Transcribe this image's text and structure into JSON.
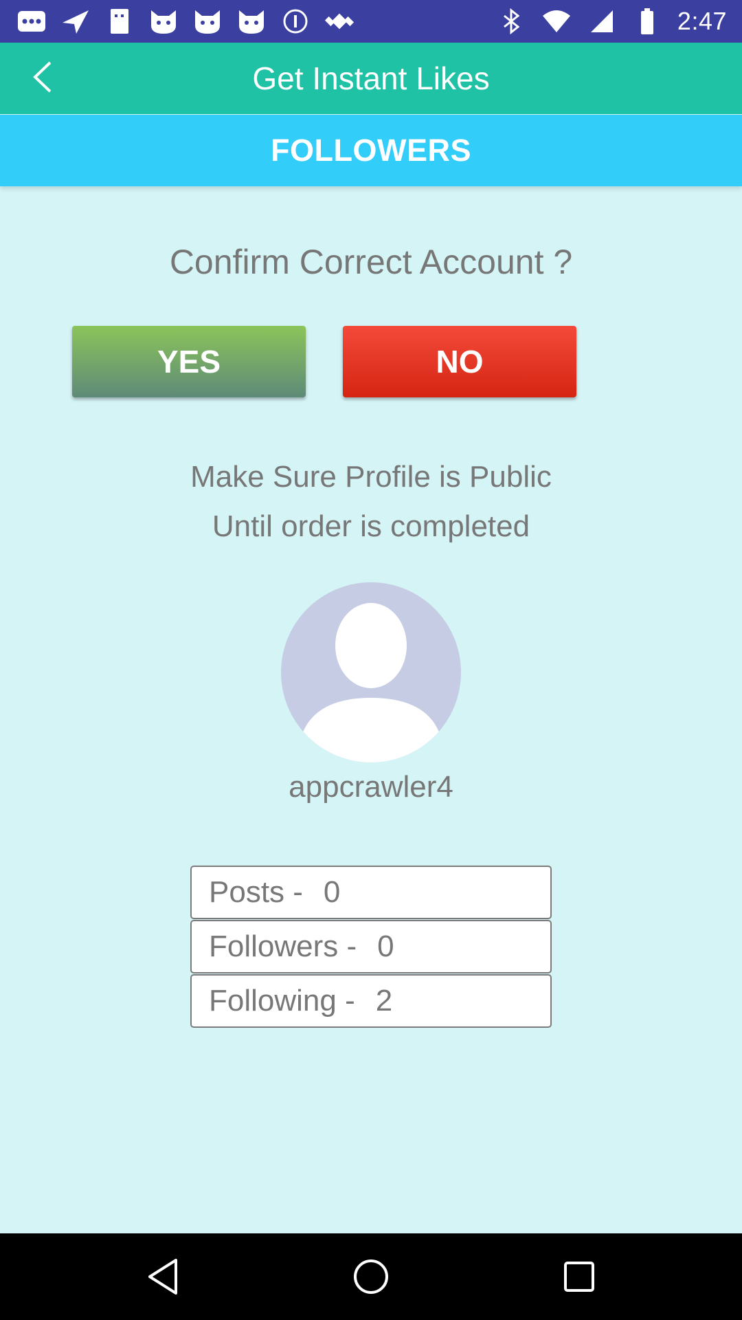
{
  "status_bar": {
    "time": "2:47",
    "left_icons": [
      "messages-icon",
      "navigation-icon",
      "signal-icon",
      "cat-icon",
      "cat-icon",
      "cat-icon",
      "info-icon",
      "satellite-fake-gps-icon"
    ],
    "right_icons": [
      "bluetooth-icon",
      "wifi-icon",
      "cellular-icon",
      "battery-icon"
    ]
  },
  "app_bar": {
    "title": "Get Instant Likes",
    "back_icon": "back-arrow-icon"
  },
  "tab": {
    "label": "FOLLOWERS"
  },
  "confirm": {
    "question": "Confirm Correct Account ?",
    "yes_label": "YES",
    "no_label": "NO"
  },
  "notice": {
    "line1": "Make Sure Profile is Public",
    "line2": "Until order is completed"
  },
  "profile": {
    "avatar_icon": "person-avatar-icon",
    "username": "appcrawler4"
  },
  "stats": [
    {
      "label": "Posts -",
      "value": "0"
    },
    {
      "label": "Followers -",
      "value": "0"
    },
    {
      "label": "Following -",
      "value": "2"
    }
  ],
  "colors": {
    "status_bar": "#3b3fa0",
    "app_bar": "#1fc2a4",
    "tab_bar": "#33cdfa",
    "background": "#d5f4f6",
    "yes_button": "#7bb25e",
    "no_button": "#e83523"
  },
  "nav_bar": {
    "icons": [
      "back-triangle-icon",
      "home-circle-icon",
      "recents-square-icon"
    ]
  }
}
